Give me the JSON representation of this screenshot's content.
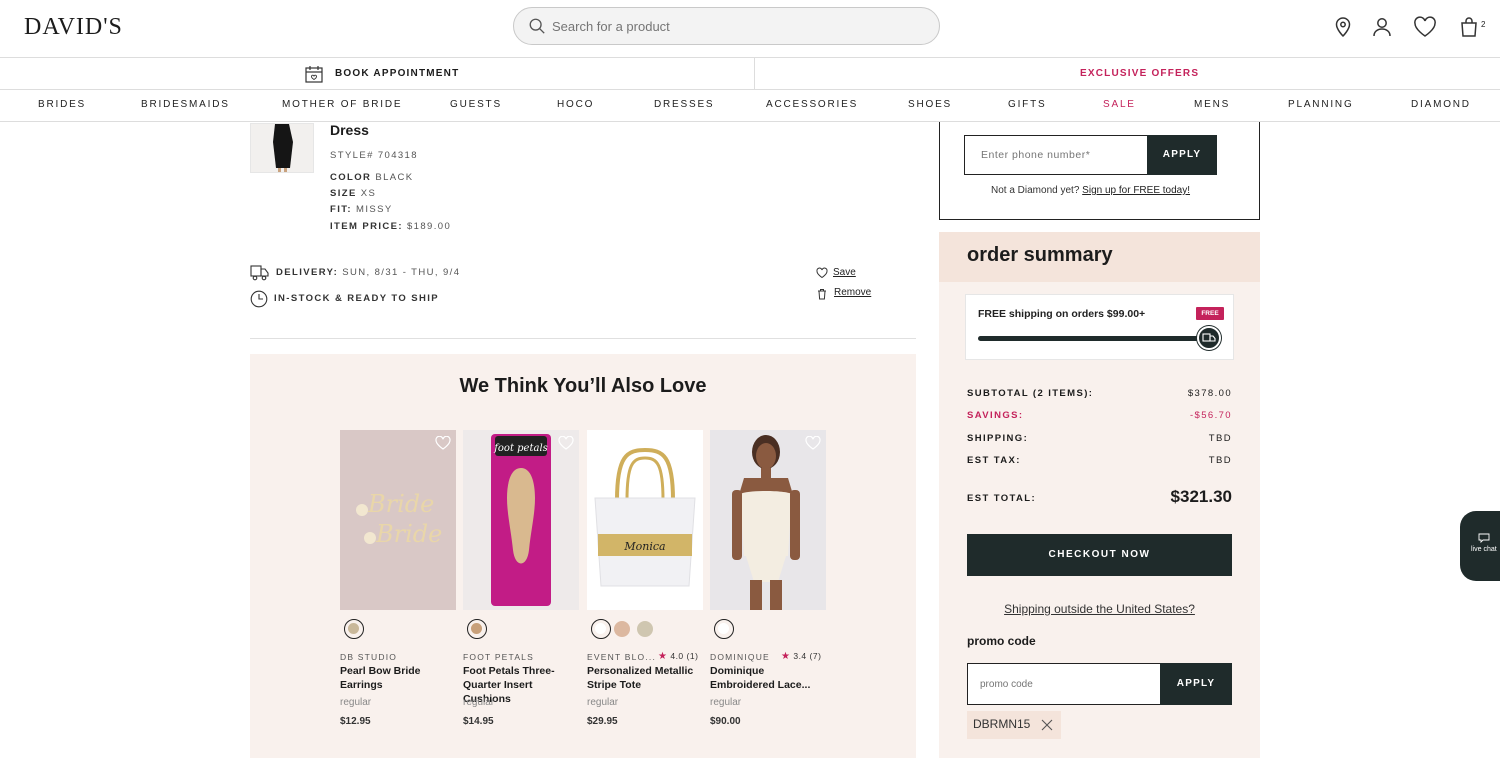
{
  "header": {
    "logo": "DAVID'S",
    "search_placeholder": "Search for a product",
    "cart_count": "2"
  },
  "utility": {
    "book_appointment": "BOOK APPOINTMENT",
    "exclusive_offers": "EXCLUSIVE OFFERS"
  },
  "nav": {
    "items": [
      "BRIDES",
      "BRIDESMAIDS",
      "MOTHER OF BRIDE",
      "GUESTS",
      "HOCO",
      "DRESSES",
      "ACCESSORIES",
      "SHOES",
      "GIFTS",
      "SALE",
      "MENS",
      "PLANNING",
      "DIAMOND"
    ]
  },
  "cart_item": {
    "title": "Dress",
    "style_label": "STYLE#",
    "style_value": "704318",
    "color_label": "COLOR",
    "color_value": "BLACK",
    "size_label": "SIZE",
    "size_value": "XS",
    "fit_label": "FIT:",
    "fit_value": "MISSY",
    "price_label": "ITEM PRICE:",
    "price_value": "$189.00",
    "delivery_label": "DELIVERY:",
    "delivery_value": "SUN, 8/31 - THU, 9/4",
    "stock_status": "IN-STOCK & READY TO SHIP",
    "save_label": "Save",
    "remove_label": "Remove"
  },
  "recommendations": {
    "title": "We Think You’ll Also Love",
    "products": [
      {
        "brand": "DB STUDIO",
        "name": "Pearl Bow Bride Earrings",
        "variant": "regular",
        "price": "$12.95",
        "rating": "",
        "swatches": [
          "#c9b89a"
        ]
      },
      {
        "brand": "FOOT PETALS",
        "name": "Foot Petals Three-Quarter Insert Cushions",
        "variant": "regular",
        "price": "$14.95",
        "rating": "",
        "swatches": [
          "#c8a07a"
        ]
      },
      {
        "brand": "EVENT BLO...",
        "name": "Personalized Metallic Stripe Tote",
        "variant": "regular",
        "price": "$29.95",
        "rating": "4.0 (1)",
        "swatches": [
          "#ffffff",
          "#dcb8a0",
          "#cfc6b0"
        ]
      },
      {
        "brand": "DOMINIQUE",
        "name": "Dominique Embroidered Lace...",
        "variant": "regular",
        "price": "$90.00",
        "rating": "3.4 (7)",
        "swatches": [
          "#ffffff"
        ]
      }
    ]
  },
  "diamond": {
    "phone_placeholder": "Enter phone number*",
    "apply_label": "APPLY",
    "not_diamond_text": "Not a Diamond yet?",
    "signup_link": "Sign up for FREE today!"
  },
  "summary": {
    "title": "order summary",
    "free_shipping_text": "FREE shipping on orders $99.00+",
    "free_badge": "FREE",
    "free_shipping_progress": 1.0,
    "subtotal_label": "SUBTOTAL (2 ITEMS):",
    "subtotal_value": "$378.00",
    "savings_label": "SAVINGS:",
    "savings_value": "-$56.70",
    "shipping_label": "SHIPPING:",
    "shipping_value": "TBD",
    "tax_label": "EST TAX:",
    "tax_value": "TBD",
    "total_label": "EST TOTAL:",
    "total_value": "$321.30",
    "checkout_label": "CHECKOUT NOW",
    "intl_link": "Shipping outside the United States?",
    "promo_label": "promo code",
    "promo_placeholder": "promo code",
    "promo_apply": "APPLY",
    "applied_code": "DBRMN15"
  },
  "livechat": {
    "label": "live chat"
  },
  "colors": {
    "accent": "#c4225b",
    "dark": "#1f2b2b",
    "blush": "#f9f1ed"
  }
}
